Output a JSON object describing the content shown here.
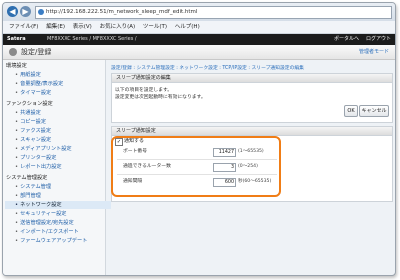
{
  "browser": {
    "url": "http://192.168.222.51/m_network_sleep_mdf_edit.html",
    "menu": [
      "ファイル(F)",
      "編集(E)",
      "表示(V)",
      "お気に入り(A)",
      "ツール(T)",
      "ヘルプ(H)"
    ]
  },
  "header": {
    "brand": "Satera",
    "crumb": "MF8XXXC Series / MF8XXXC Series /",
    "portal": "ポータルへ",
    "logout": "ログアウト"
  },
  "subheader": {
    "title": "設定/登録",
    "manager": "管理者モード"
  },
  "sidebar": {
    "groups": [
      {
        "label": "環境設定",
        "items": [
          "用紙設定",
          "音量調整/表示設定",
          "タイマー設定"
        ]
      },
      {
        "label": "ファンクション設定",
        "items": [
          "共通設定",
          "コピー設定",
          "ファクス設定",
          "スキャン設定",
          "メディアプリント設定",
          "プリンター設定",
          "レポート出力設定"
        ]
      },
      {
        "label": "システム管理設定",
        "items": [
          "システム管理",
          "部門管理",
          "ネットワーク設定",
          "セキュリティー設定",
          "送信管理設定/宛先設定",
          "インポート/エクスポート",
          "ファームウェアアップデート"
        ]
      }
    ],
    "active": "ネットワーク設定"
  },
  "main": {
    "breadcrumb": "設定/登録 : システム管理設定 : ネットワーク設定 : TCP/IP設定 : スリープ通知設定の編集",
    "panel1_title": "スリープ通知設定の編集",
    "desc_line1": "以下の項目を設定します。",
    "desc_line2": "設定変更は次回起動時に有効になります。",
    "ok_label": "OK",
    "cancel_label": "キャンセル",
    "panel2_title": "スリープ通知設定",
    "notify_label": "通知する",
    "rows": [
      {
        "label": "ポート番号",
        "value": "11427",
        "range": "(1～65535)"
      },
      {
        "label": "通過できるルーター数",
        "value": "3",
        "range": "(0～254)"
      },
      {
        "label": "通知間隔",
        "value": "600",
        "range": "秒(60～65535)"
      }
    ]
  },
  "colors": {
    "highlight": "#f07d16",
    "link": "#2a6ebb",
    "header": "#1c1c1c"
  }
}
